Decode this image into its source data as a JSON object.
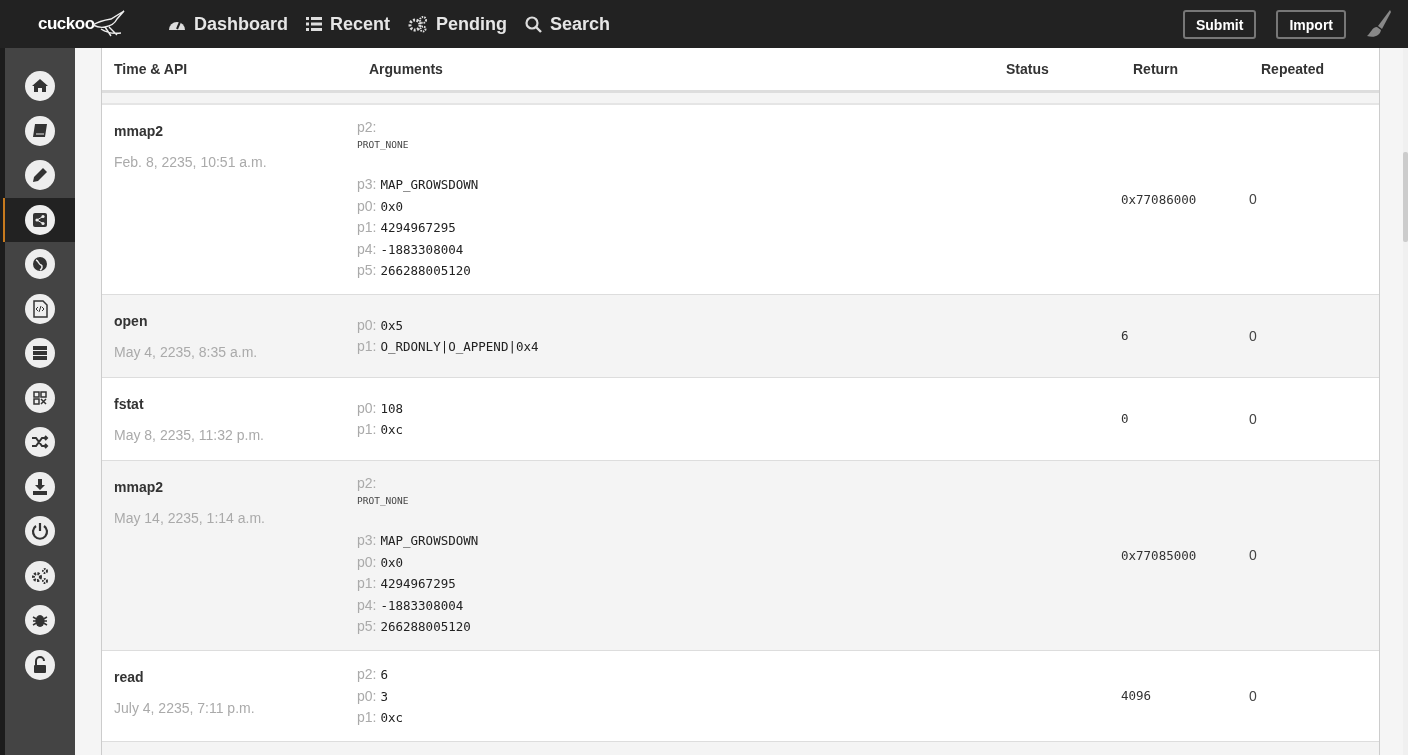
{
  "topbar": {
    "logo": "cuckoo",
    "nav": [
      {
        "label": "Dashboard"
      },
      {
        "label": "Recent"
      },
      {
        "label": "Pending"
      },
      {
        "label": "Search"
      }
    ],
    "buttons": [
      "Submit",
      "Import"
    ]
  },
  "sidebar": {
    "items": [
      {
        "selected": false
      },
      {
        "selected": false
      },
      {
        "selected": false
      },
      {
        "selected": true
      },
      {
        "selected": false
      },
      {
        "selected": false
      },
      {
        "selected": false
      },
      {
        "selected": false
      },
      {
        "selected": false
      },
      {
        "selected": false
      },
      {
        "selected": false
      },
      {
        "selected": false
      },
      {
        "selected": false
      },
      {
        "selected": false
      }
    ]
  },
  "table": {
    "columns": [
      "Time & API",
      "Arguments",
      "Status",
      "Return",
      "Repeated"
    ],
    "rows": [
      {
        "api": "mmap2",
        "time": "Feb. 8, 2235, 10:51 a.m.",
        "args": [
          {
            "name": "p2:",
            "value": "PROT_NONE",
            "kind": "block"
          },
          {
            "name": "p3:",
            "value": "MAP_GROWSDOWN",
            "kind": "inline"
          },
          {
            "name": "p0:",
            "value": "0x0",
            "kind": "inline"
          },
          {
            "name": "p1:",
            "value": "4294967295",
            "kind": "inline"
          },
          {
            "name": "p4:",
            "value": "-1883308004",
            "kind": "inline"
          },
          {
            "name": "p5:",
            "value": "266288005120",
            "kind": "inline"
          }
        ],
        "return": "0x77086000",
        "repeated": "0"
      },
      {
        "api": "open",
        "time": "May 4, 2235, 8:35 a.m.",
        "args": [
          {
            "name": "p0:",
            "value": "0x5",
            "kind": "inline"
          },
          {
            "name": "p1:",
            "value": "O_RDONLY|O_APPEND|0x4",
            "kind": "inline"
          }
        ],
        "return": "6",
        "repeated": "0"
      },
      {
        "api": "fstat",
        "time": "May 8, 2235, 11:32 p.m.",
        "args": [
          {
            "name": "p0:",
            "value": "108",
            "kind": "inline"
          },
          {
            "name": "p1:",
            "value": "0xc",
            "kind": "inline"
          }
        ],
        "return": "0",
        "repeated": "0"
      },
      {
        "api": "mmap2",
        "time": "May 14, 2235, 1:14 a.m.",
        "args": [
          {
            "name": "p2:",
            "value": "PROT_NONE",
            "kind": "block"
          },
          {
            "name": "p3:",
            "value": "MAP_GROWSDOWN",
            "kind": "inline"
          },
          {
            "name": "p0:",
            "value": "0x0",
            "kind": "inline"
          },
          {
            "name": "p1:",
            "value": "4294967295",
            "kind": "inline"
          },
          {
            "name": "p4:",
            "value": "-1883308004",
            "kind": "inline"
          },
          {
            "name": "p5:",
            "value": "266288005120",
            "kind": "inline"
          }
        ],
        "return": "0x77085000",
        "repeated": "0"
      },
      {
        "api": "read",
        "time": "July 4, 2235, 7:11 p.m.",
        "args": [
          {
            "name": "p2:",
            "value": "6",
            "kind": "inline"
          },
          {
            "name": "p0:",
            "value": "3",
            "kind": "inline"
          },
          {
            "name": "p1:",
            "value": "0xc",
            "kind": "inline"
          }
        ],
        "return": "4096",
        "repeated": "0"
      }
    ]
  }
}
